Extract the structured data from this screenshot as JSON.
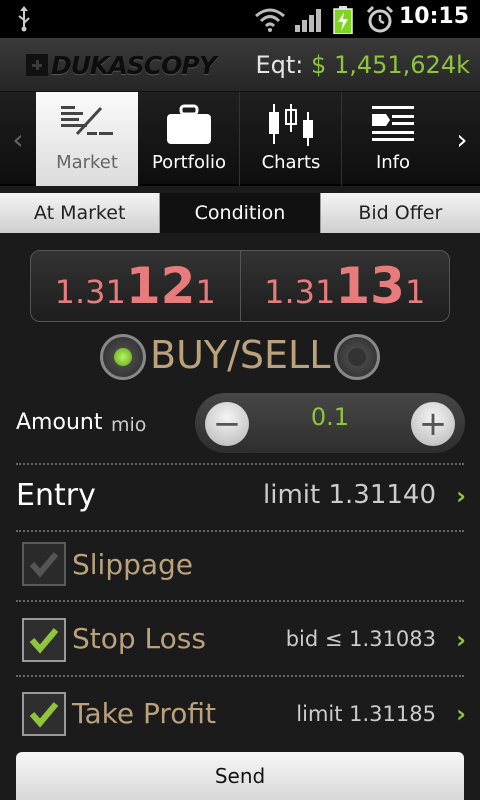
{
  "status_bar": {
    "time": "10:15",
    "icons": [
      "usb-icon",
      "wifi-icon",
      "signal-icon",
      "battery-charging-icon",
      "alarm-icon"
    ]
  },
  "header": {
    "logo_text": "DUKASCOPY",
    "equity_label": "Eqt:",
    "equity_value": "$ 1,451,624k"
  },
  "nav": {
    "tabs": [
      {
        "label": "Market",
        "icon": "market-icon",
        "active": true
      },
      {
        "label": "Portfolio",
        "icon": "briefcase-icon",
        "active": false
      },
      {
        "label": "Charts",
        "icon": "candlestick-icon",
        "active": false
      },
      {
        "label": "Info",
        "icon": "info-list-icon",
        "active": false
      }
    ]
  },
  "subtabs": [
    {
      "label": "At Market",
      "active": false
    },
    {
      "label": "Condition",
      "active": true
    },
    {
      "label": "Bid Offer",
      "active": false
    }
  ],
  "quote": {
    "bid": {
      "prefix": "1.31",
      "big": "12",
      "suffix": "1"
    },
    "ask": {
      "prefix": "1.31",
      "big": "13",
      "suffix": "1"
    }
  },
  "order_side": {
    "label": "BUY/SELL",
    "selected": "buy"
  },
  "amount": {
    "label": "Amount",
    "unit": "mio",
    "value": "0.1"
  },
  "entry": {
    "label": "Entry",
    "value": "limit 1.31140"
  },
  "slippage": {
    "label": "Slippage",
    "checked": false,
    "enabled": false
  },
  "stop_loss": {
    "label": "Stop Loss",
    "value": "bid ≤ 1.31083",
    "checked": true
  },
  "take_profit": {
    "label": "Take Profit",
    "value": "limit 1.31185",
    "checked": true
  },
  "send_label": "Send",
  "colors": {
    "accent_green": "#8fc43c",
    "price_red": "#e87c7c",
    "gold_label": "#b9a27c"
  }
}
